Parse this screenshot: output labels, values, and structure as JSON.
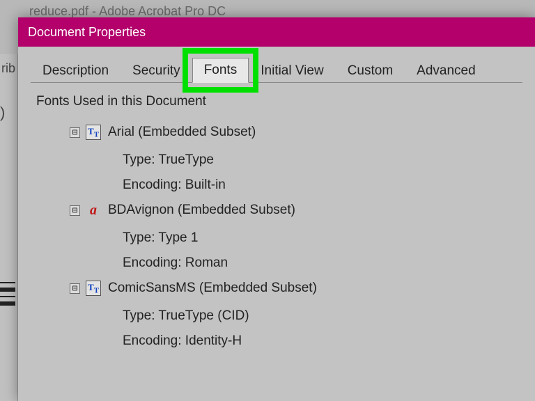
{
  "bg": {
    "title": "reduce.pdf - Adobe Acrobat Pro DC",
    "sidebar_text": "rib"
  },
  "dialog": {
    "title": "Document Properties"
  },
  "tabs": {
    "description": "Description",
    "security": "Security",
    "fonts": "Fonts",
    "initial_view": "Initial View",
    "custom": "Custom",
    "advanced": "Advanced"
  },
  "section": {
    "label": "Fonts Used in this Document"
  },
  "fonts": [
    {
      "name": "Arial (Embedded Subset)",
      "type_label": "Type:",
      "type_value": "TrueType",
      "encoding_label": "Encoding:",
      "encoding_value": "Built-in",
      "icon_style": "tt"
    },
    {
      "name": "BDAvignon (Embedded Subset)",
      "type_label": "Type:",
      "type_value": "Type 1",
      "encoding_label": "Encoding:",
      "encoding_value": "Roman",
      "icon_style": "red"
    },
    {
      "name": "ComicSansMS (Embedded Subset)",
      "type_label": "Type:",
      "type_value": "TrueType (CID)",
      "encoding_label": "Encoding:",
      "encoding_value": "Identity-H",
      "icon_style": "tt"
    }
  ],
  "expander_glyph": "⊟"
}
